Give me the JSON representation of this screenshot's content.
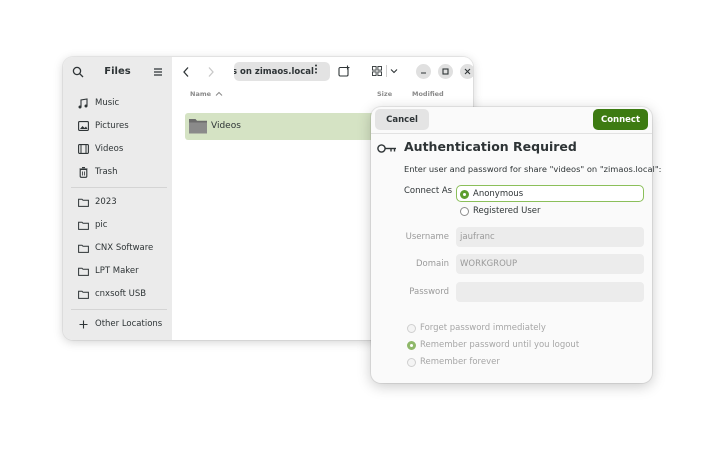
{
  "files_window": {
    "sidebar": {
      "title": "Files",
      "places": [
        {
          "label": "Music",
          "icon": "music-icon"
        },
        {
          "label": "Pictures",
          "icon": "pictures-icon"
        },
        {
          "label": "Videos",
          "icon": "videos-icon"
        },
        {
          "label": "Trash",
          "icon": "trash-icon"
        }
      ],
      "bookmarks": [
        {
          "label": "2023",
          "icon": "folder-icon"
        },
        {
          "label": "pic",
          "icon": "folder-icon"
        },
        {
          "label": "CNX Software",
          "icon": "folder-icon"
        },
        {
          "label": "LPT Maker",
          "icon": "folder-icon"
        },
        {
          "label": "cnxsoft USB",
          "icon": "folder-icon"
        }
      ],
      "other_locations": "Other Locations"
    },
    "path_bar": "s on zimaos.local",
    "columns": {
      "name": "Name",
      "size": "Size",
      "modified": "Modified"
    },
    "files": [
      {
        "name": "Videos",
        "selected": true
      }
    ]
  },
  "auth_dialog": {
    "cancel_label": "Cancel",
    "connect_label": "Connect",
    "title": "Authentication Required",
    "message": "Enter user and password for share \"videos\" on \"zimaos.local\":",
    "connect_as_label": "Connect As",
    "connect_as_options": [
      {
        "label": "Anonymous",
        "selected": true
      },
      {
        "label": "Registered User",
        "selected": false
      }
    ],
    "fields": [
      {
        "label": "Username",
        "value": "jaufranc"
      },
      {
        "label": "Domain",
        "value": "WORKGROUP"
      },
      {
        "label": "Password",
        "value": ""
      }
    ],
    "remember_options": [
      {
        "label": "Forget password immediately",
        "selected": false
      },
      {
        "label": "Remember password until you logout",
        "selected": true
      },
      {
        "label": "Remember forever",
        "selected": false
      }
    ]
  },
  "colors": {
    "accent": "#3d7b12",
    "selection": "#d5e3c4",
    "sidebar_bg": "#ebebeb"
  }
}
